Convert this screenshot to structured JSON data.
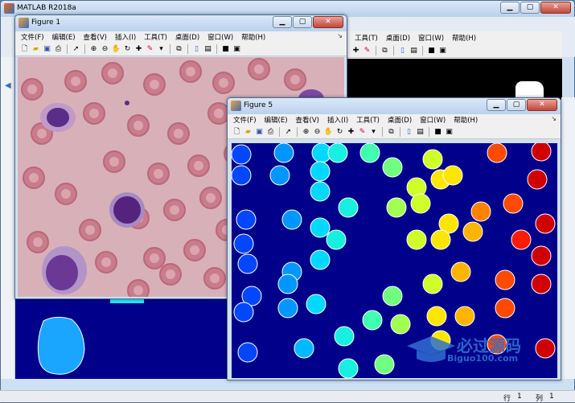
{
  "main_window": {
    "title": "MATLAB R2018a"
  },
  "back_menu": [
    "工具(T)",
    "桌面(D)",
    "窗口(W)",
    "帮助(H)"
  ],
  "figure1": {
    "title": "Figure 1",
    "menu": [
      "文件(F)",
      "编辑(E)",
      "查看(V)",
      "插入(I)",
      "工具(T)",
      "桌面(D)",
      "窗口(W)",
      "帮助(H)"
    ]
  },
  "figure5": {
    "title": "Figure 5",
    "menu": [
      "文件(F)",
      "编辑(E)",
      "查看(V)",
      "插入(I)",
      "工具(T)",
      "桌面(D)",
      "窗口(W)",
      "帮助(H)"
    ]
  },
  "toolbar_icons": [
    "new-file-icon",
    "open-folder-icon",
    "save-icon",
    "print-icon",
    "pointer-icon",
    "zoom-in-icon",
    "zoom-out-icon",
    "pan-icon",
    "rotate-icon",
    "data-cursor-icon",
    "brush-icon",
    "link-icon",
    "colorbar-icon",
    "legend-icon",
    "hide-plot-tools-icon",
    "show-plot-tools-icon"
  ],
  "watermark": {
    "brand": "必过源码",
    "url": "Biguo100.com"
  },
  "status": {
    "row_label": "行",
    "row_value": "1",
    "col_label": "列",
    "col_value": "1"
  },
  "colors": {
    "label_background": "#00008b",
    "smear_background": "#d8b0b8",
    "title_bar": "#c6daf1"
  }
}
